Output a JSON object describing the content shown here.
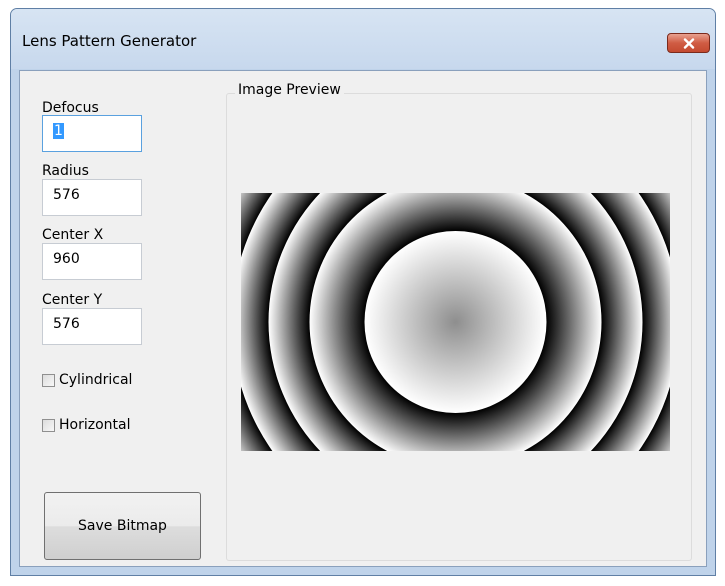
{
  "window": {
    "title": "Lens Pattern Generator",
    "close_icon": "close-icon"
  },
  "fields": {
    "defocus": {
      "label": "Defocus",
      "value": "1"
    },
    "radius": {
      "label": "Radius",
      "value": "576"
    },
    "center_x": {
      "label": "Center X",
      "value": "960"
    },
    "center_y": {
      "label": "Center Y",
      "value": "576"
    }
  },
  "options": {
    "cylindrical": {
      "label": "Cylindrical",
      "checked": false
    },
    "horizontal": {
      "label": "Horizontal",
      "checked": false
    }
  },
  "actions": {
    "save_label": "Save Bitmap"
  },
  "preview": {
    "group_label": "Image Preview"
  },
  "colors": {
    "titlebar": "#c7d8ed",
    "client_bg": "#f0f0f0",
    "selection": "#3399ff",
    "close_button": "#c44a30"
  }
}
